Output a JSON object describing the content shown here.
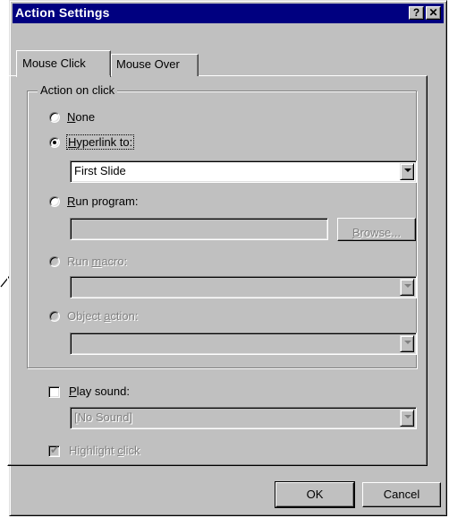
{
  "window": {
    "title": "Action Settings",
    "help_btn": "?",
    "close_btn": "✕"
  },
  "tabs": [
    {
      "label": "Mouse Click",
      "selected": true
    },
    {
      "label": "Mouse Over",
      "selected": false
    }
  ],
  "group": {
    "legend": "Action on click",
    "none": {
      "letter": "N",
      "rest": "one",
      "checked": false
    },
    "hyperlink": {
      "letter": "H",
      "rest": "yperlink to:",
      "checked": true,
      "value": "First Slide"
    },
    "run_program": {
      "letter": "R",
      "rest": "un program:",
      "value": "",
      "browse_letter": "B",
      "browse_rest": "rowse..."
    },
    "run_macro": {
      "pre": "Run ",
      "letter": "m",
      "rest": "acro:",
      "value": ""
    },
    "object_action": {
      "pre": "Object ",
      "letter": "a",
      "rest": "ction:",
      "value": ""
    }
  },
  "play_sound": {
    "letter": "P",
    "rest": "lay sound:",
    "checked": false,
    "value": "[No Sound]"
  },
  "highlight_click": {
    "pre": "Highlight ",
    "letter": "c",
    "rest": "lick",
    "checked": true
  },
  "buttons": {
    "ok": "OK",
    "cancel": "Cancel"
  }
}
